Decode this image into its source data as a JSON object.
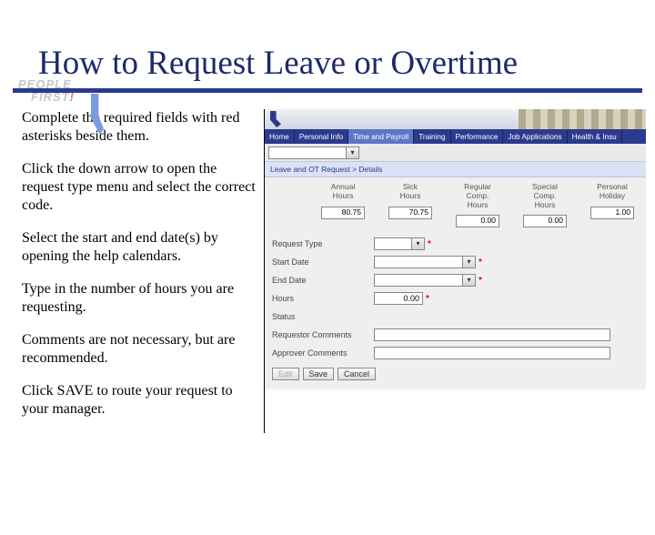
{
  "logo": {
    "line1": "PEOPLE",
    "line2": "FIRST",
    "bang": "!"
  },
  "title": "How to Request Leave or Overtime",
  "instructions": [
    "Complete the required fields with red asterisks beside them.",
    "Click the down arrow to open the request type menu and select the correct code.",
    "Select the start and end date(s) by opening the help calendars.",
    "Type in the number of hours you are requesting.",
    "Comments are not necessary, but are recommended.",
    "Click SAVE to route your request to your manager."
  ],
  "tabs": [
    "Home",
    "Personal Info",
    "Time and Payroll",
    "Training",
    "Performance",
    "Job Applications",
    "Health & Insu"
  ],
  "active_tab_index": 2,
  "breadcrumb": "Leave and OT Request > Details",
  "balances": [
    {
      "label1": "Annual",
      "label2": "Hours",
      "value": "80.75"
    },
    {
      "label1": "Sick",
      "label2": "Hours",
      "value": "70.75"
    },
    {
      "label1": "Regular",
      "label2": "Comp.",
      "label3": "Hours",
      "value": "0.00"
    },
    {
      "label1": "Special",
      "label2": "Comp.",
      "label3": "Hours",
      "value": "0.00"
    },
    {
      "label1": "Personal",
      "label2": "Holiday",
      "value": "1.00"
    }
  ],
  "form": {
    "request_type": {
      "label": "Request Type",
      "required": "*"
    },
    "start_date": {
      "label": "Start Date",
      "required": "*"
    },
    "end_date": {
      "label": "End Date",
      "required": "*"
    },
    "hours": {
      "label": "Hours",
      "value": "0.00",
      "required": "*"
    },
    "status": {
      "label": "Status"
    },
    "req_comments": {
      "label": "Requestor Comments"
    },
    "appr_comments": {
      "label": "Approver Comments"
    }
  },
  "buttons": {
    "edit": "Edit",
    "save": "Save",
    "cancel": "Cancel"
  },
  "chevron": "▾"
}
